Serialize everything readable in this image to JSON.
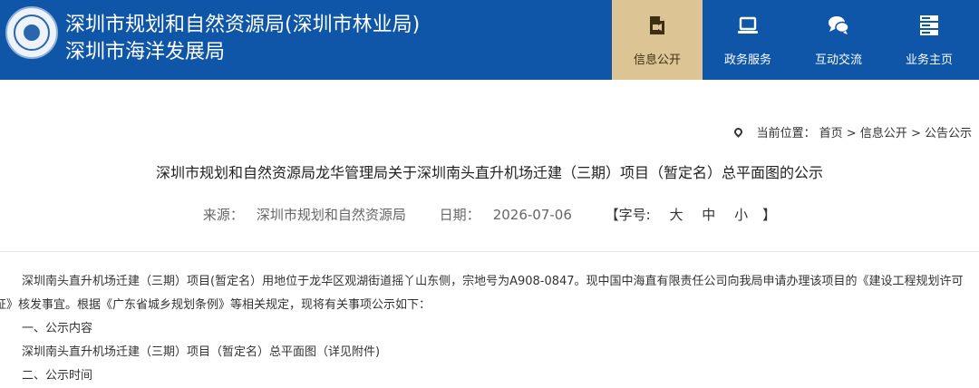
{
  "header": {
    "title_line1": "深圳市规划和自然资源局(深圳市林业局)",
    "title_line2": "深圳市海洋发展局"
  },
  "nav": [
    {
      "label": "信息公开",
      "icon": "news-icon",
      "active": true
    },
    {
      "label": "政务服务",
      "icon": "monitor-icon",
      "active": false
    },
    {
      "label": "互动交流",
      "icon": "chat-icon",
      "active": false
    },
    {
      "label": "业务主页",
      "icon": "server-icon",
      "active": false
    }
  ],
  "breadcrumb": {
    "prefix": "当前位置：",
    "path": "首页 > 信息公开 > 公告公示"
  },
  "article": {
    "title": "深圳市规划和自然资源局龙华管理局关于深圳南头直升机场迁建（三期）项目（暂定名）总平面图的公示",
    "source_label": "来源：",
    "source": "深圳市规划和自然资源局",
    "date_label": "日期：",
    "date": "2026-07-06",
    "font_size_label": "【字号:",
    "font_large": "大",
    "font_medium": "中",
    "font_small": "小",
    "font_close": "】",
    "p1": "深圳南头直升机场迁建（三期）项目(暂定名）用地位于龙华区观湖街道摇丫山东侧，宗地号为A908-0847。现中国中海直有限责任公司向我局申请办理该项目的《建设工程规划许可证》核发事宜。根据《广东省城乡规划条例》等相关规定，现将有关事项公示如下：",
    "l1": "一、公示内容",
    "l2": "深圳南头直升机场迁建（三期）项目（暂定名）总平面图（详见附件)",
    "l3": "二、公示时间"
  },
  "colors": {
    "header_blue": "#0f56a8",
    "active_tab": "#dcc495"
  }
}
